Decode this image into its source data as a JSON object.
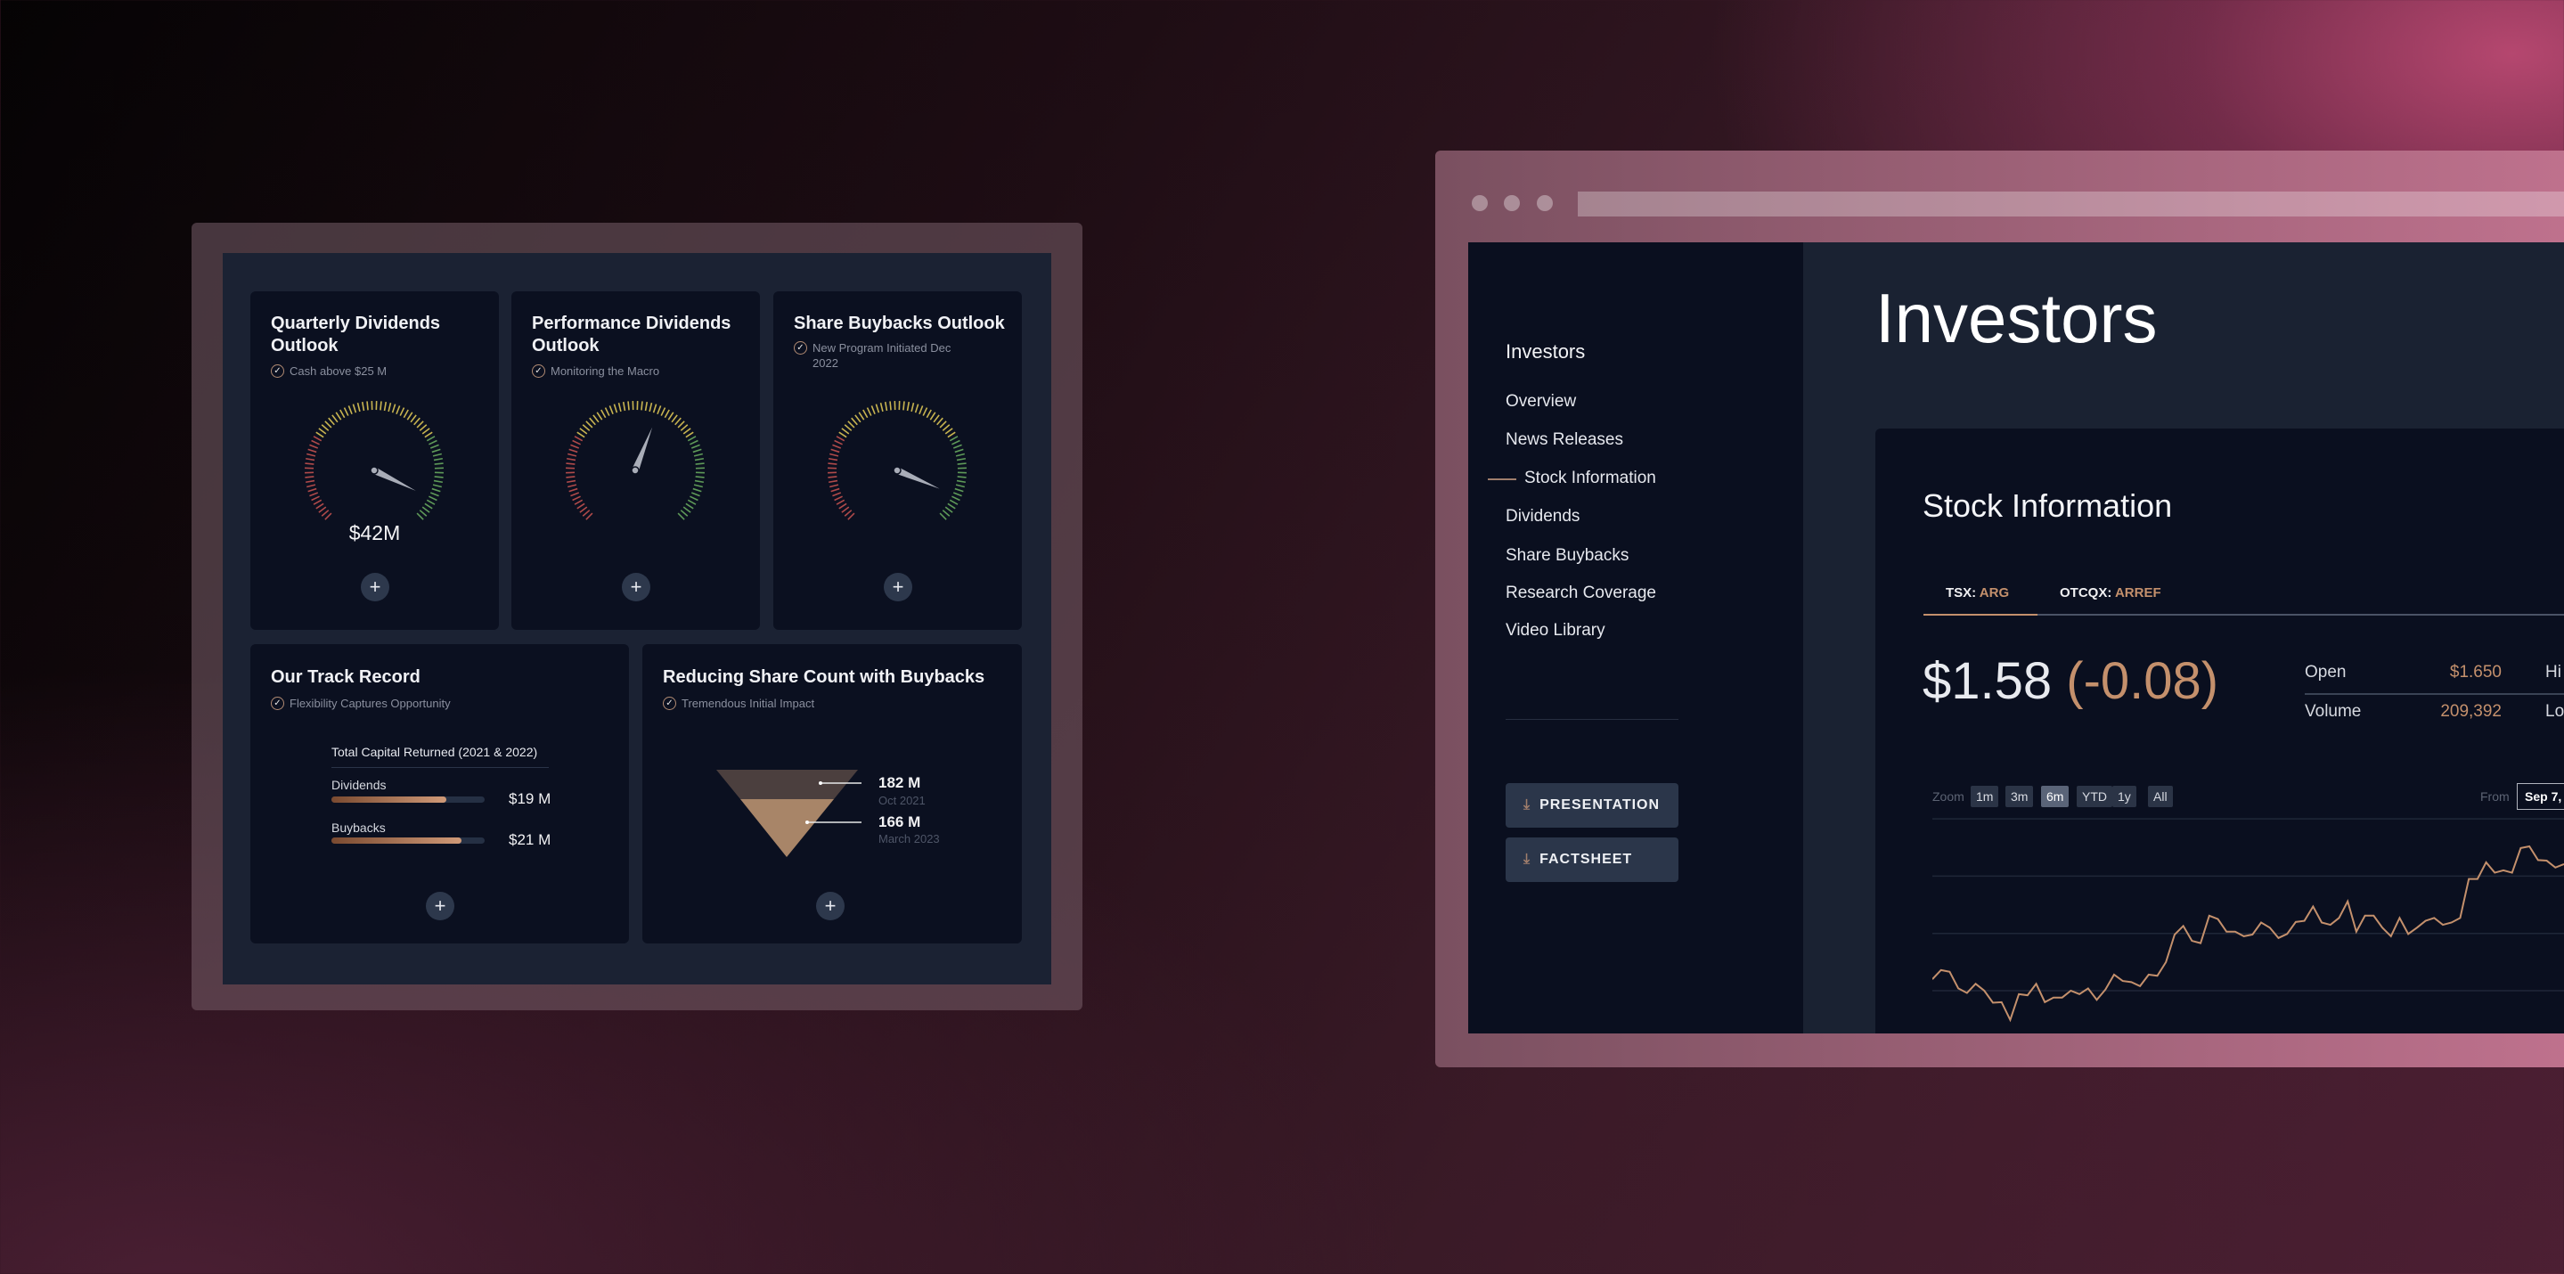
{
  "dashboard": {
    "cards": [
      {
        "title_l1": "Quarterly Dividends",
        "title_l2": "Outlook",
        "subtitle": "Cash above $25 M",
        "value": "$42M",
        "gauge_level": 0.93
      },
      {
        "title_l1": "Performance Dividends",
        "title_l2": "Outlook",
        "subtitle": "Monitoring the Macro",
        "gauge_level": 0.58
      },
      {
        "title_l1": "Share Buybacks Outlook",
        "subtitle_l1": "New Program Initiated Dec",
        "subtitle_l2": "2022",
        "gauge_level": 0.92
      }
    ],
    "track_record": {
      "title": "Our Track Record",
      "subtitle": "Flexibility Captures Opportunity",
      "heading": "Total Capital Returned (2021 & 2022)",
      "bars": [
        {
          "label": "Dividends",
          "value": "$19 M",
          "fill": 0.75
        },
        {
          "label": "Buybacks",
          "value": "$21 M",
          "fill": 0.85
        }
      ]
    },
    "share_count": {
      "title": "Reducing Share Count with Buybacks",
      "subtitle": "Tremendous Initial Impact",
      "points": [
        {
          "value": "182 M",
          "date": "Oct 2021"
        },
        {
          "value": "166 M",
          "date": "March 2023"
        }
      ]
    },
    "plus_label": "+"
  },
  "site": {
    "page_title": "Investors",
    "sidebar": {
      "heading": "Investors",
      "items": [
        "Overview",
        "News Releases",
        "Stock Information",
        "Dividends",
        "Share Buybacks",
        "Research Coverage",
        "Video Library"
      ],
      "active": "Stock Information",
      "buttons": [
        "PRESENTATION",
        "FACTSHEET"
      ]
    },
    "stock": {
      "title": "Stock Information",
      "tabs": [
        {
          "exchange": "TSX:",
          "ticker": "ARG"
        },
        {
          "exchange": "OTCQX:",
          "ticker": "ARREF"
        }
      ],
      "price": "$1.58",
      "change": "(-0.08)",
      "stats": [
        {
          "label": "Open",
          "value": "$1.650",
          "next": "Hi"
        },
        {
          "label": "Volume",
          "value": "209,392",
          "next": "Lo"
        }
      ],
      "zoom_label": "Zoom",
      "zoom_options": [
        "1m",
        "3m",
        "6m",
        "YTD",
        "1y",
        "All"
      ],
      "zoom_active": "6m",
      "from_label": "From",
      "from_value": "Sep 7,"
    }
  },
  "colors": {
    "accent": "#c4906c",
    "card": "#0b1020",
    "button": "#2b364a"
  },
  "chart_data": {
    "type": "line",
    "grid": true,
    "series": [
      {
        "values": [
          0.2,
          0.36,
          0.33,
          0.04,
          -0.04,
          0.12,
          0,
          -0.21,
          -0.2,
          -0.51,
          -0.06,
          -0.08,
          0.12,
          -0.2,
          -0.12,
          -0.12,
          0,
          -0.06,
          0.04,
          -0.16,
          0.02,
          0.28,
          0.17,
          0.15,
          0.08,
          0.28,
          0.26,
          0.5,
          0.98,
          1.13,
          0.87,
          0.83,
          1.31,
          1.25,
          1.03,
          1.03,
          0.95,
          0.98,
          1.19,
          1.1,
          0.92,
          0.99,
          1.2,
          1.22,
          1.47,
          1.19,
          1.15,
          1.27,
          1.56,
          1.03,
          1.31,
          1.31,
          1.1,
          0.95,
          1.27,
          0.99,
          1.1,
          1.22,
          1.27,
          1.15,
          1.19,
          1.27,
          1.95,
          1.95,
          2.24,
          2.06,
          2.1,
          2.06,
          2.49,
          2.52,
          2.28,
          2.27,
          2.15,
          2.21
        ]
      }
    ],
    "ylim": [
      -0.6,
      3
    ]
  }
}
